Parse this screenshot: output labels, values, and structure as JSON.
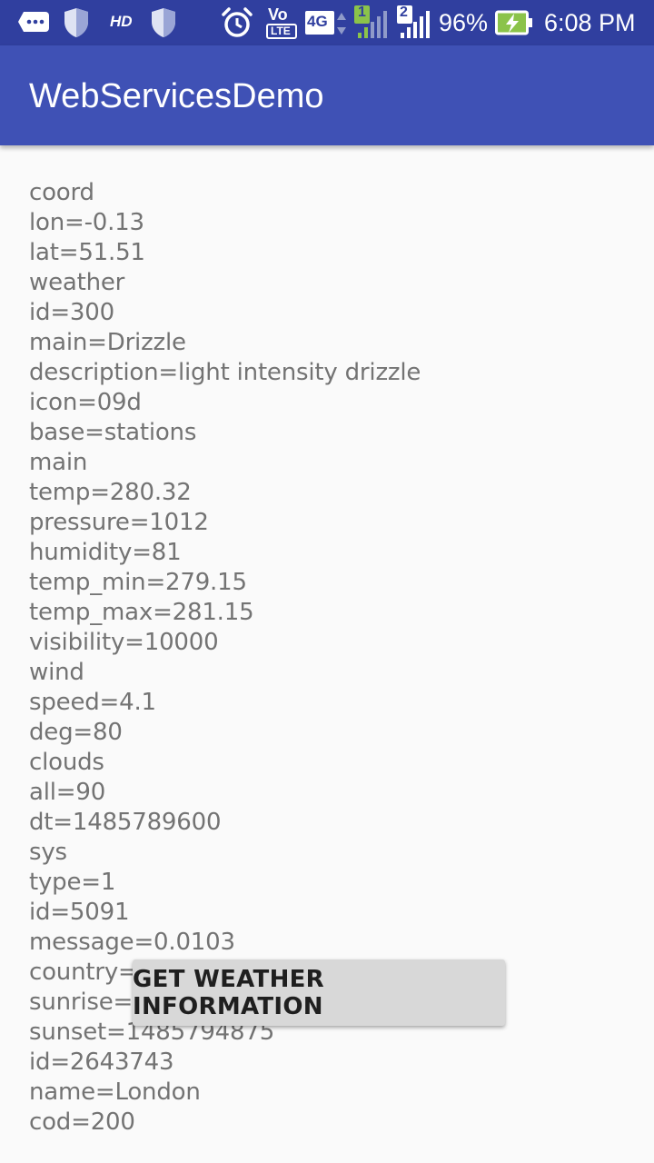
{
  "status_bar": {
    "hd_label": "HD",
    "volte_top": "Vo",
    "volte_bottom": "LTE",
    "network_label": "4G",
    "sim1_label": "1",
    "sim2_label": "2",
    "battery_percent": "96%",
    "time": "6:08 PM",
    "icons": [
      "messaging-icon",
      "shield-icon",
      "hd-icon",
      "shield-icon",
      "alarm-icon",
      "volte-icon",
      "4g-icon",
      "signal-sim1-icon",
      "signal-sim2-icon",
      "battery-charging-icon"
    ]
  },
  "app_bar": {
    "title": "WebServicesDemo",
    "color": "#3f51b5",
    "status_color": "#303f9f"
  },
  "weather_lines": [
    "coord",
    "lon=-0.13",
    "lat=51.51",
    "weather",
    "id=300",
    "main=Drizzle",
    "description=light intensity drizzle",
    "icon=09d",
    "base=stations",
    "main",
    "temp=280.32",
    "pressure=1012",
    "humidity=81",
    "temp_min=279.15",
    "temp_max=281.15",
    "visibility=10000",
    "wind",
    "speed=4.1",
    "deg=80",
    "clouds",
    "all=90",
    "dt=1485789600",
    "sys",
    "type=1",
    "id=5091",
    "message=0.0103",
    "country=GB",
    "sunrise=1485762037",
    "sunset=1485794875",
    "id=2643743",
    "name=London",
    "cod=200"
  ],
  "button": {
    "label": "GET WEATHER INFORMATION"
  }
}
